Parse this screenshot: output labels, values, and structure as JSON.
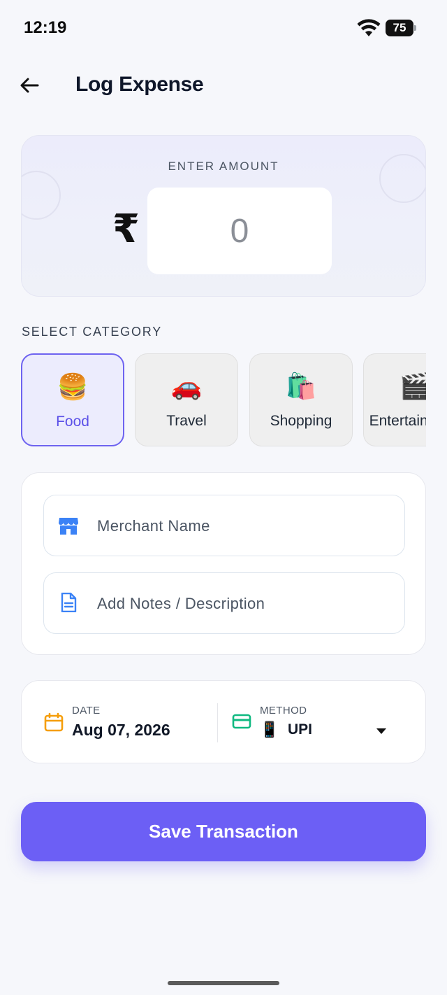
{
  "status_bar": {
    "time": "12:19",
    "battery": "75"
  },
  "header": {
    "title": "Log Expense"
  },
  "amount": {
    "label": "ENTER AMOUNT",
    "currency_symbol": "₹",
    "value": "0"
  },
  "category": {
    "label": "SELECT CATEGORY",
    "items": [
      {
        "emoji": "🍔",
        "label": "Food",
        "selected": true
      },
      {
        "emoji": "🚗",
        "label": "Travel",
        "selected": false
      },
      {
        "emoji": "🛍️",
        "label": "Shopping",
        "selected": false
      },
      {
        "emoji": "🎬",
        "label": "Entertainment",
        "selected": false
      }
    ]
  },
  "details": {
    "merchant_placeholder": "Merchant Name",
    "notes_placeholder": "Add Notes / Description"
  },
  "date_method": {
    "date_label": "DATE",
    "date_value": "Aug 07, 2026",
    "method_label": "METHOD",
    "method_emoji": "📱",
    "method_value": "UPI"
  },
  "save_label": "Save Transaction",
  "colors": {
    "accent": "#6c5ff5",
    "date_icon": "#f59e0b",
    "method_icon": "#10b981",
    "field_icon": "#3b82f6"
  }
}
